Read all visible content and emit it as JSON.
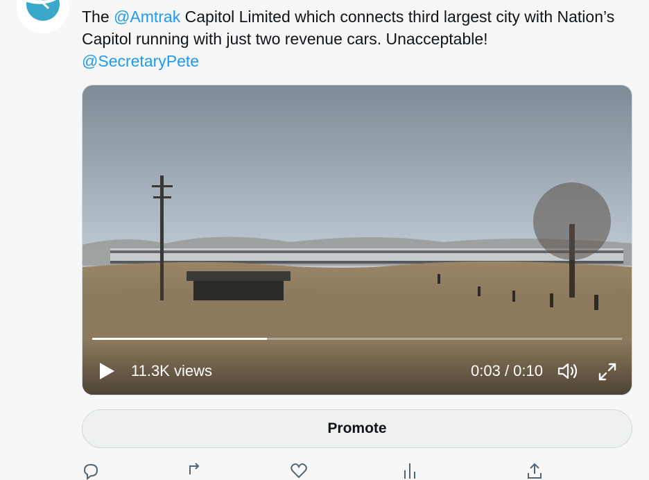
{
  "tweet": {
    "text_prefix": "The ",
    "mention_amtrak": "@Amtrak",
    "text_body": " Capitol Limited which connects third largest city with Nation’s Capitol running with just two revenue cars.  Unacceptable!",
    "mention_pete": "@SecretaryPete"
  },
  "video": {
    "views": "11.3K views",
    "time": "0:03 / 0:10",
    "progress": 0.33
  },
  "promote_label": "Promote",
  "actions": [
    {
      "icon": "reply-icon"
    },
    {
      "icon": "retweet-icon"
    },
    {
      "icon": "like-icon"
    },
    {
      "icon": "views-icon"
    },
    {
      "icon": "share-icon"
    }
  ],
  "colors": {
    "link": "#1d9bf0",
    "avatar_accent": "#3aa9c9",
    "button_bg": "#eff1f1"
  }
}
